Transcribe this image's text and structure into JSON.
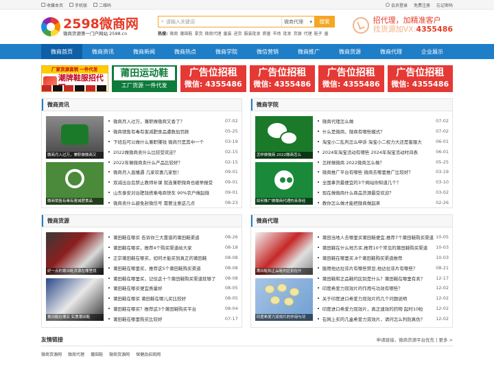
{
  "topbar": {
    "left": [
      "收藏本页",
      "手机版",
      "二维码"
    ],
    "right": [
      "会员登录",
      "免费注册",
      "忘记密码"
    ]
  },
  "logo": {
    "num": "2598",
    "name": "微商网",
    "sub": "微商货源第一门户网站 2598.cn"
  },
  "search": {
    "placeholder": "请输入关键词",
    "category": "微商代理",
    "button": "搜索",
    "hot_label": "热搜:",
    "hot": [
      "微商",
      "莆田鞋",
      "拿货",
      "微商代理",
      "童装",
      "进货",
      "服装批发",
      "质量",
      "市场",
      "批发",
      "货源",
      "代理",
      "鞋子",
      "童"
    ]
  },
  "header_right": {
    "line1": "招代理，加精准客户",
    "line2_prefix": "找货源加VX:",
    "line2_num": "4355486"
  },
  "nav": [
    "微商首页",
    "微商资讯",
    "微商新闻",
    "微商热点",
    "微商学院",
    "微信营销",
    "微商推广",
    "微商货源",
    "微商代理",
    "企业展示"
  ],
  "ads": {
    "ad1_top": "厂家货源直销 一件代发",
    "ad1_main": "潮牌鞋服招代理",
    "ad2_title": "莆田运动鞋",
    "ad2_sub": "工厂货源 一件代发",
    "rent_title": "广告位招租",
    "rent_sub": "微信: 4355486"
  },
  "sections": {
    "news": {
      "title": "微商资讯",
      "captions": [
        "微商月入过万，兼职做微商又",
        "微商销售有毒有害减肥食品"
      ],
      "items": [
        {
          "t": "微商月入过万，兼职做微商又香了？",
          "d": "07-02"
        },
        {
          "t": "微商销售有毒有害减肥食品遭数加罚款",
          "d": "05-25"
        },
        {
          "t": "下班后可以做什么兼职赚钱 微商只是其中一个",
          "d": "03-19"
        },
        {
          "t": "2022做微商卖什么比较受欢迎？",
          "d": "02-15"
        },
        {
          "t": "2022年做微商卖什么产品比较好？",
          "d": "02-15"
        },
        {
          "t": "微商月入直播遇 几家欢喜几家愁！",
          "d": "09-01"
        },
        {
          "t": "双减出台后禁止教师补课 就连兼职微商也被举报受",
          "d": "09-01"
        },
        {
          "t": "山东泰安对台肥钱搭乘电商快车 90%农户做起微",
          "d": "09-01"
        },
        {
          "t": "微商卖什么避免封微信号 需要注意这几点",
          "d": "08-23"
        }
      ]
    },
    "academy": {
      "title": "微商学院",
      "captions": [
        "怎样做微商 2022微商怎么",
        "如何推广做微商代理的亲身经"
      ],
      "items": [
        {
          "t": "微商代理怎么做",
          "d": "07-02"
        },
        {
          "t": "什么是微商，微商有哪些模式？",
          "d": "07-02"
        },
        {
          "t": "淘宝小二乱判怎么申诉 淘宝小二权力大还是客服大",
          "d": "06-01"
        },
        {
          "t": "2024年淘宝活动有哪些 2024年淘宝活动时间表",
          "d": "06-01"
        },
        {
          "t": "怎样做微商 2022微商怎么做？",
          "d": "05-25"
        },
        {
          "t": "微商推广平台有哪些 微商去哪里推广比较好？",
          "d": "03-19"
        },
        {
          "t": "全国拿货最便宜的3个网站你知道几个？",
          "d": "03-10"
        },
        {
          "t": "现在做微商什么商品货源最受欢迎？",
          "d": "03-02"
        },
        {
          "t": "教你怎么做才能把微商做起来",
          "d": "02-26"
        }
      ]
    },
    "supply": {
      "title": "微商货源",
      "captions": [
        "好一点的莆田鞋货源在哪里找",
        "莆田鞋在哪买 实惠莆田鞋"
      ],
      "items": [
        {
          "t": "莆田鞋在哪买 告诉你三大靠谱的莆田鞋渠道",
          "d": "08-26"
        },
        {
          "t": "莆田鞋在哪买，推荐4个购买渠道给大家",
          "d": "08-18"
        },
        {
          "t": "正宗莆田鞋在哪买，如何才能买到真正的莆田鞋",
          "d": "08-08"
        },
        {
          "t": "莆田鞋在哪里买，推荐这5个莆田鞋购买渠道",
          "d": "08-08"
        },
        {
          "t": "莆田鞋在哪里买，记住这十个莆田鞋购买渠道就够了",
          "d": "08-08"
        },
        {
          "t": "莆田鞋在哪买便宜质量好",
          "d": "08-05"
        },
        {
          "t": "莆田鞋在哪买 莆田鞋在哪儿买比较好",
          "d": "08-05"
        },
        {
          "t": "莆田鞋在哪买？推荐这3个莆田鞋购买平台",
          "d": "08-04"
        },
        {
          "t": "莆田鞋在哪里购买比较好",
          "d": "07-17"
        }
      ]
    },
    "agent": {
      "title": "微商代理",
      "captions": [
        "莆田鞋和正品鞋的区别在什",
        "印度希爱力双效片的作用与功"
      ],
      "items": [
        {
          "t": "莆田当地人去哪里买莆田鞋便宜,推荐7个莆田鞋购买渠道",
          "d": "10-05"
        },
        {
          "t": "莆田鞋在什么地方买,推荐10个常见的莆田鞋购买渠道",
          "d": "10-03"
        },
        {
          "t": "莆田鞋在哪里买,8个莆田鞋购买渠道推荐",
          "d": "10-03"
        },
        {
          "t": "服用他达拉非片有哪些禁忌,他达拉非片有哪些？",
          "d": "08-21"
        },
        {
          "t": "莆田鞋和正品鞋的区别是什么？莆田鞋在哪里有卖？",
          "d": "12-17"
        },
        {
          "t": "印度希爱力双效片的作用与功效有哪些？",
          "d": "12-02"
        },
        {
          "t": "关于印度进口希爱力双效片的几个问题说明",
          "d": "12-02"
        },
        {
          "t": "印度进口希爱力双效片，真正速效的药物 起时10粒",
          "d": "12-02"
        },
        {
          "t": "在网上买的几盒希爱力双效片，请问怎么判别真伪？",
          "d": "12-02"
        }
      ]
    }
  },
  "friend": {
    "title": "友情链接",
    "right": "申请链接，微商货源平台优先 | 更多 >",
    "links": [
      "微商货源网",
      "微商代理",
      "莆田鞋",
      "微商货源网",
      "保健品招商网"
    ]
  }
}
